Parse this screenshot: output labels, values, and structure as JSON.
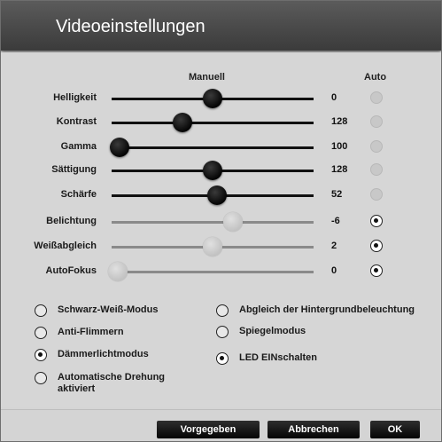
{
  "dialog": {
    "title": "Videoeinstellungen"
  },
  "columns": {
    "manual": "Manuell",
    "auto": "Auto"
  },
  "sliders": [
    {
      "label": "Helligkeit",
      "value": "0",
      "level": 0.5,
      "auto": false,
      "enabled": true
    },
    {
      "label": "Kontrast",
      "value": "128",
      "level": 0.35,
      "auto": false,
      "enabled": true
    },
    {
      "label": "Gamma",
      "value": "100",
      "level": 0.04,
      "auto": false,
      "enabled": true
    },
    {
      "label": "Sättigung",
      "value": "128",
      "level": 0.5,
      "auto": false,
      "enabled": true
    },
    {
      "label": "Schärfe",
      "value": "52",
      "level": 0.52,
      "auto": false,
      "enabled": true
    },
    {
      "label": "Belichtung",
      "value": "-6",
      "level": 0.6,
      "auto": true,
      "enabled": false
    },
    {
      "label": "Weißabgleich",
      "value": "2",
      "level": 0.5,
      "auto": true,
      "enabled": false
    },
    {
      "label": "AutoFokus",
      "value": "0",
      "level": 0.0,
      "auto": true,
      "enabled": false
    }
  ],
  "options": {
    "bw_mode": {
      "label": "Schwarz-Weiß-Modus",
      "checked": false
    },
    "flicker": {
      "label": "Anti-Flimmern",
      "checked": false
    },
    "lowlight": {
      "label": "Dämmerlichtmodus",
      "checked": true
    },
    "rotation": {
      "label_line1": "Automatische Drehung",
      "label_line2": "aktiviert",
      "checked": false
    },
    "backlight": {
      "label": "Abgleich der Hintergrundbeleuchtung",
      "checked": false
    },
    "mirror": {
      "label": "Spiegelmodus",
      "checked": false
    },
    "led": {
      "label": "LED EINschalten",
      "checked": true
    }
  },
  "buttons": {
    "default": "Vorgegeben",
    "cancel": "Abbrechen",
    "ok": "OK"
  }
}
